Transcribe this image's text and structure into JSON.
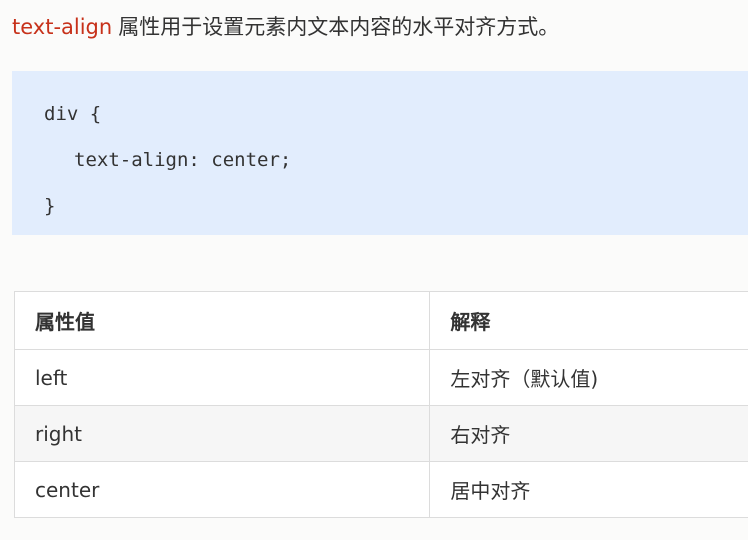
{
  "intro": {
    "property_name": "text-align",
    "description": "属性用于设置元素内文本内容的水平对齐方式。"
  },
  "code": {
    "lines": [
      "div {",
      "text-align: center;",
      "}"
    ]
  },
  "table": {
    "headers": [
      "属性值",
      "解释"
    ],
    "rows": [
      [
        "left",
        "左对齐（默认值)"
      ],
      [
        "right",
        "右对齐"
      ],
      [
        "center",
        "居中对齐"
      ]
    ]
  },
  "colors": {
    "accent": "#c7311a",
    "code_background": "#e2edfd",
    "text": "#333333"
  }
}
